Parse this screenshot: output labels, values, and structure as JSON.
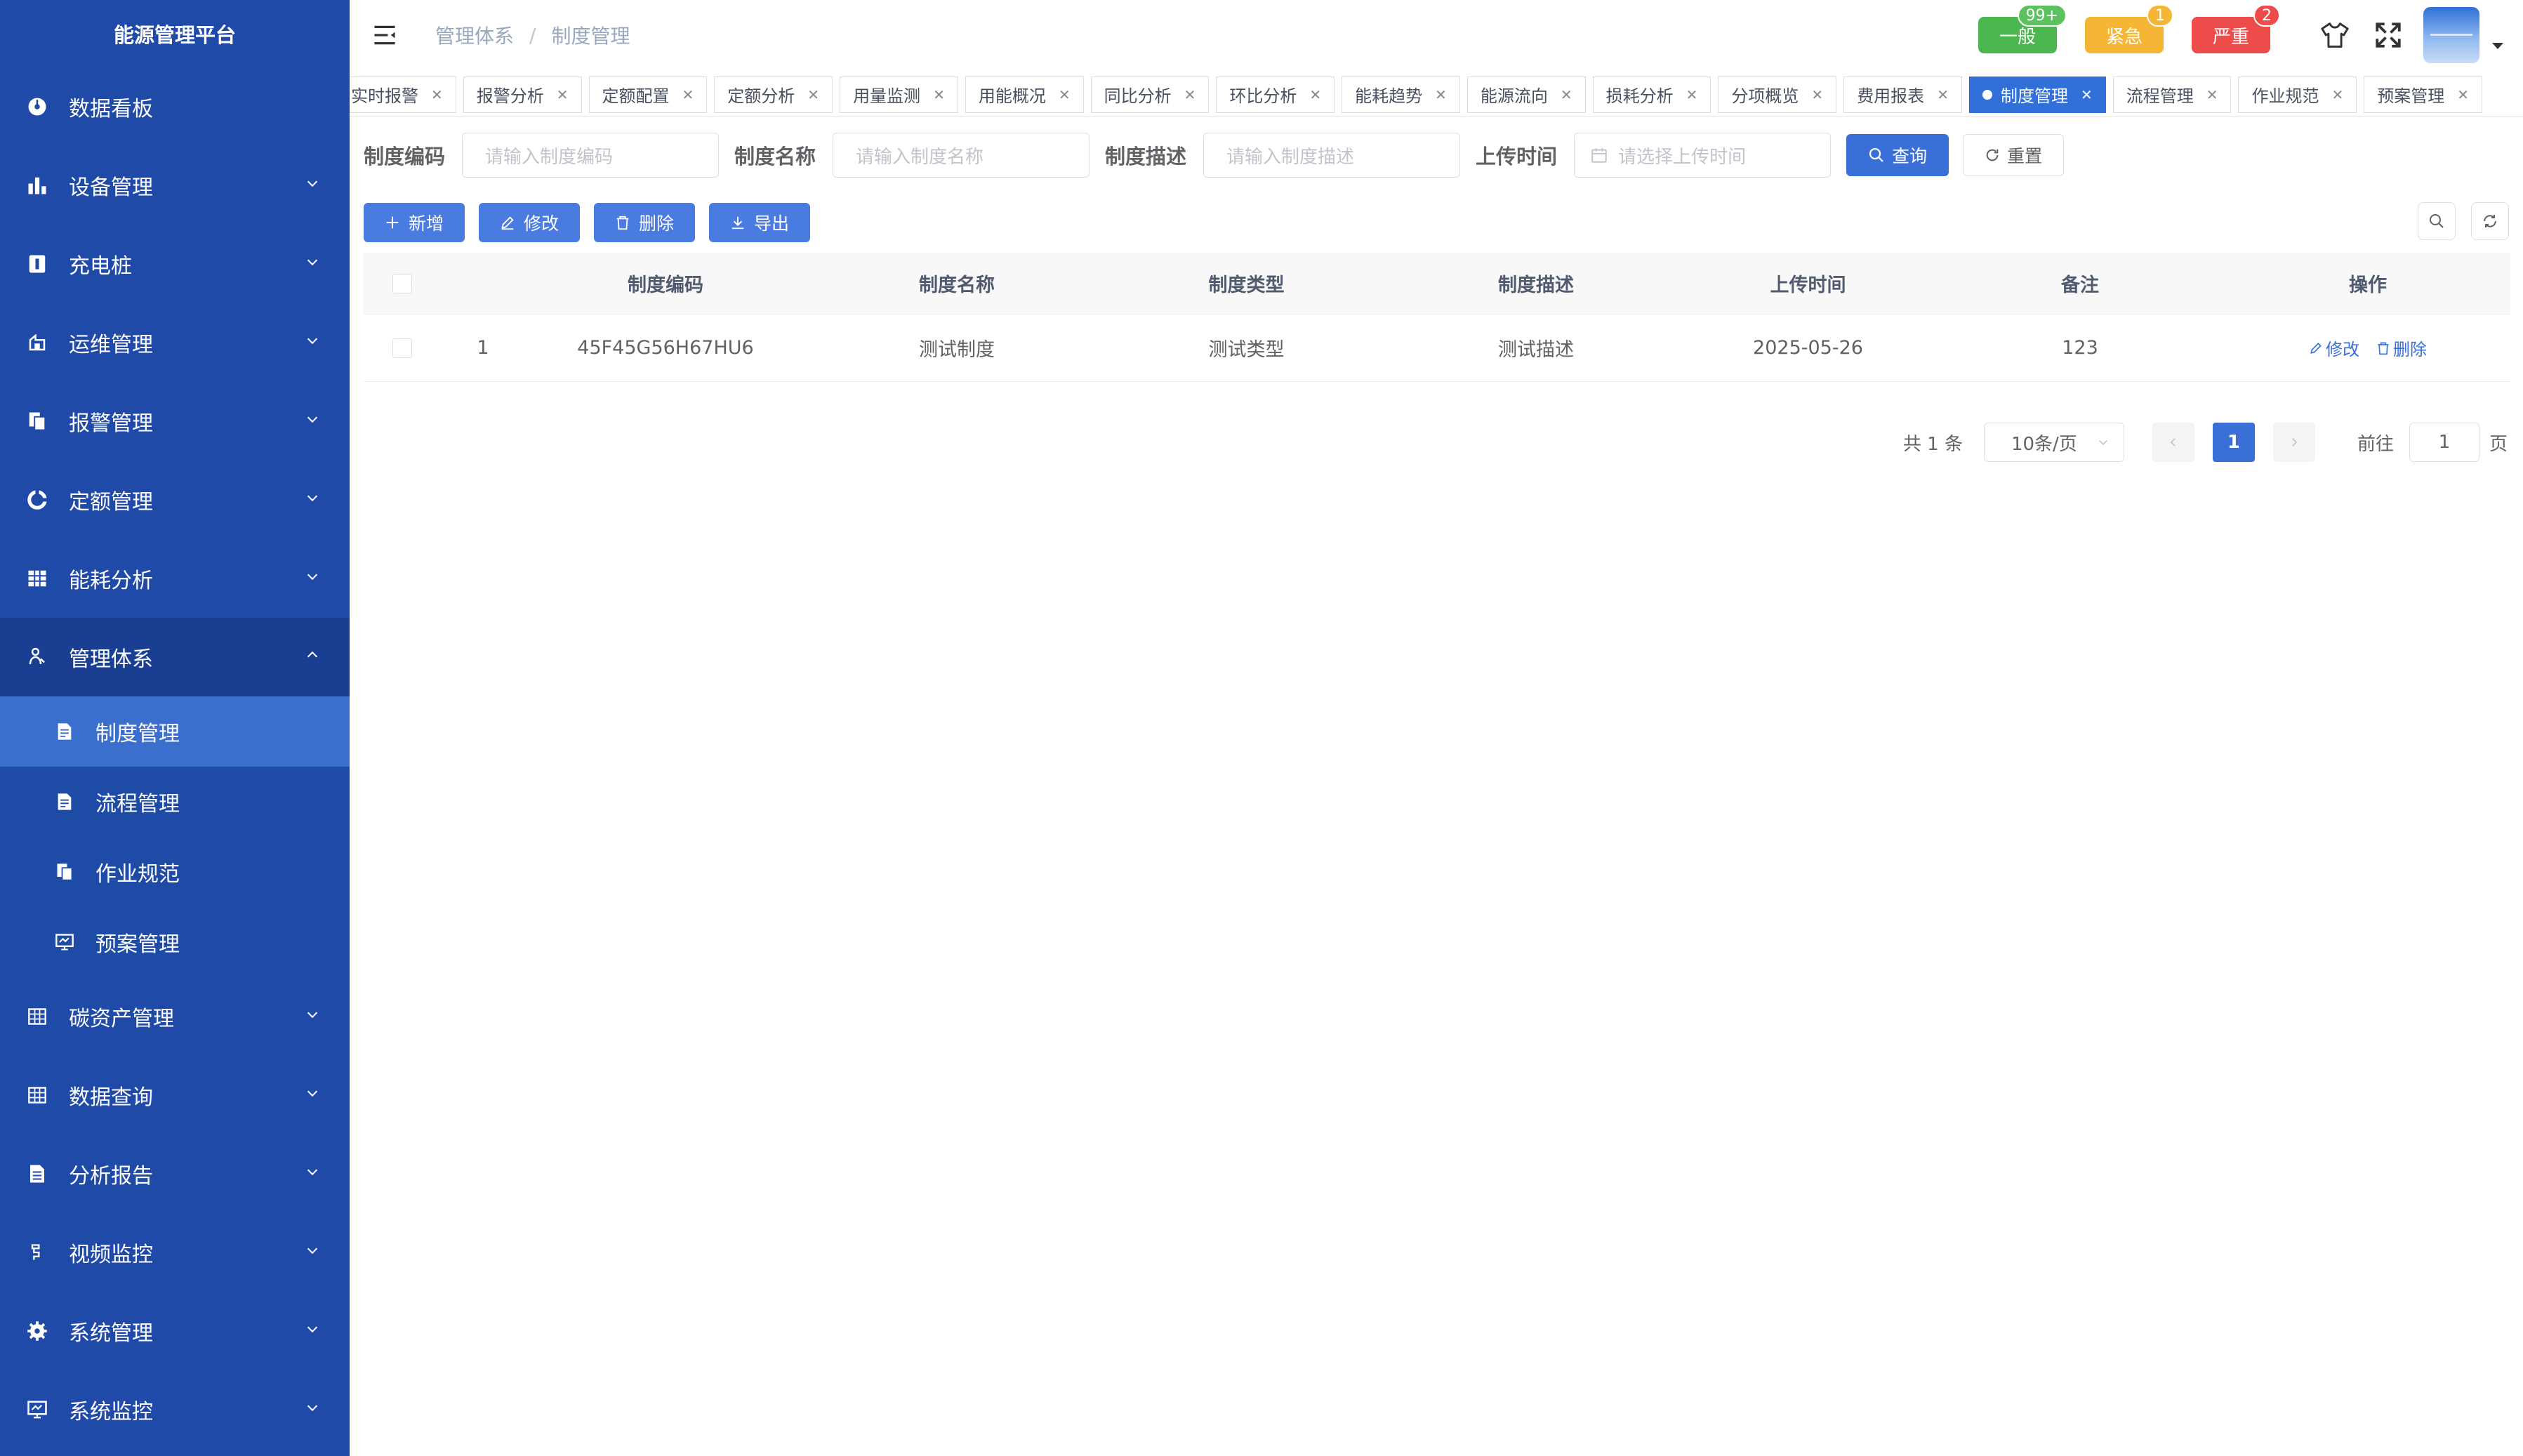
{
  "app": {
    "title": "能源管理平台"
  },
  "sidebar": {
    "items": [
      {
        "label": "数据看板",
        "icon": "dashboard-icon",
        "has_children": false
      },
      {
        "label": "设备管理",
        "icon": "bar-chart-icon",
        "has_children": true
      },
      {
        "label": "充电桩",
        "icon": "charger-icon",
        "has_children": true
      },
      {
        "label": "运维管理",
        "icon": "maintenance-icon",
        "has_children": true
      },
      {
        "label": "报警管理",
        "icon": "alarm-icon",
        "has_children": true
      },
      {
        "label": "定额管理",
        "icon": "quota-icon",
        "has_children": true
      },
      {
        "label": "能耗分析",
        "icon": "grid-icon",
        "has_children": true
      },
      {
        "label": "管理体系",
        "icon": "user-system-icon",
        "has_children": true,
        "expanded": true
      }
    ],
    "submenu": [
      {
        "label": "制度管理",
        "icon": "document-icon",
        "active": true
      },
      {
        "label": "流程管理",
        "icon": "document-icon",
        "active": false
      },
      {
        "label": "作业规范",
        "icon": "copy-icon",
        "active": false
      },
      {
        "label": "预案管理",
        "icon": "monitor-icon",
        "active": false
      }
    ],
    "items_after": [
      {
        "label": "碳资产管理",
        "icon": "table-icon",
        "has_children": true
      },
      {
        "label": "数据查询",
        "icon": "table-icon",
        "has_children": true
      },
      {
        "label": "分析报告",
        "icon": "report-icon",
        "has_children": true
      },
      {
        "label": "视频监控",
        "icon": "video-icon",
        "has_children": true
      },
      {
        "label": "系统管理",
        "icon": "gear-icon",
        "has_children": true
      },
      {
        "label": "系统监控",
        "icon": "monitor-icon",
        "has_children": true
      }
    ]
  },
  "header": {
    "breadcrumb": [
      "管理体系",
      "制度管理"
    ],
    "breadcrumb_sep": "/",
    "alerts": [
      {
        "label": "一般",
        "count": "99+",
        "color": "#4cb74f",
        "badge_color": "#5cc15f"
      },
      {
        "label": "紧急",
        "count": "1",
        "color": "#f5b636",
        "badge_color": "#f5b636"
      },
      {
        "label": "严重",
        "count": "2",
        "color": "#ee4b4b",
        "badge_color": "#ee4b4b"
      }
    ]
  },
  "tags": [
    {
      "label": "实时报警",
      "active": false
    },
    {
      "label": "报警分析",
      "active": false
    },
    {
      "label": "定额配置",
      "active": false
    },
    {
      "label": "定额分析",
      "active": false
    },
    {
      "label": "用量监测",
      "active": false
    },
    {
      "label": "用能概况",
      "active": false
    },
    {
      "label": "同比分析",
      "active": false
    },
    {
      "label": "环比分析",
      "active": false
    },
    {
      "label": "能耗趋势",
      "active": false
    },
    {
      "label": "能源流向",
      "active": false
    },
    {
      "label": "损耗分析",
      "active": false
    },
    {
      "label": "分项概览",
      "active": false
    },
    {
      "label": "费用报表",
      "active": false
    },
    {
      "label": "制度管理",
      "active": true
    },
    {
      "label": "流程管理",
      "active": false
    },
    {
      "label": "作业规范",
      "active": false
    },
    {
      "label": "预案管理",
      "active": false
    }
  ],
  "search": {
    "code_label": "制度编码",
    "code_placeholder": "请输入制度编码",
    "name_label": "制度名称",
    "name_placeholder": "请输入制度名称",
    "desc_label": "制度描述",
    "desc_placeholder": "请输入制度描述",
    "time_label": "上传时间",
    "time_placeholder": "请选择上传时间",
    "query_label": "查询",
    "reset_label": "重置"
  },
  "toolbar": {
    "add_label": "新增",
    "edit_label": "修改",
    "delete_label": "删除",
    "export_label": "导出"
  },
  "table": {
    "columns": [
      "制度编码",
      "制度名称",
      "制度类型",
      "制度描述",
      "上传时间",
      "备注",
      "操作"
    ],
    "rows": [
      {
        "index": "1",
        "code": "45F45G56H67HU6",
        "name": "测试制度",
        "type": "测试类型",
        "desc": "测试描述",
        "time": "2025-05-26",
        "note": "123",
        "edit_label": "修改",
        "delete_label": "删除"
      }
    ]
  },
  "pagination": {
    "total_text": "共 1 条",
    "page_size": "10条/页",
    "current_page": "1",
    "goto_label": "前往",
    "goto_value": "1",
    "page_suffix": "页"
  },
  "colors": {
    "sidebar_bg": "#1f4aa8",
    "primary": "#3a6fd8"
  }
}
